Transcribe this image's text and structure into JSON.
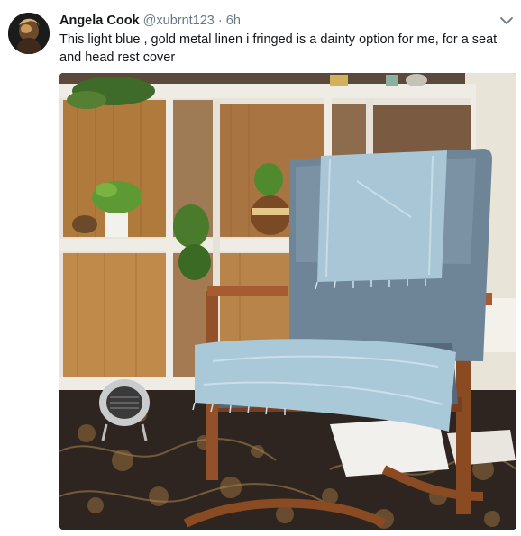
{
  "tweet": {
    "author_name": "Angela Cook",
    "handle": "@xubrnt123",
    "separator": "·",
    "time": "6h",
    "text": "This light blue , gold metal linen i fringed is a dainty option for me, for a seat and head rest cover"
  },
  "icons": {
    "more": "chevron-down-icon",
    "avatar": "user-avatar"
  },
  "colors": {
    "name": "#14171a",
    "meta": "#657786",
    "text": "#14171a",
    "caret": "#657786"
  }
}
